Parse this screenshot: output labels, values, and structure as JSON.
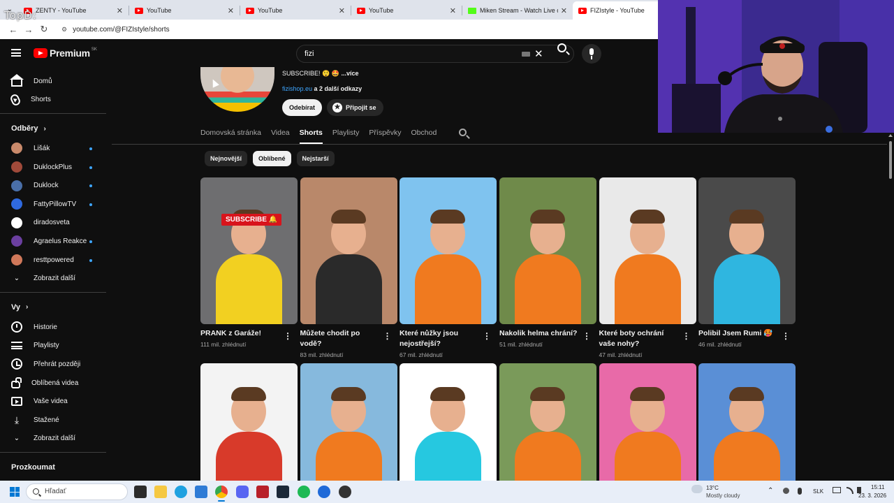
{
  "watermark": "TopD:",
  "browser": {
    "tabs": [
      {
        "title": "ZENTY - YouTube",
        "close": "✕",
        "type": "yt"
      },
      {
        "title": "YouTube",
        "close": "✕",
        "type": "yt"
      },
      {
        "title": "YouTube",
        "close": "✕",
        "type": "yt"
      },
      {
        "title": "YouTube",
        "close": "✕",
        "type": "yt"
      },
      {
        "title": "Miken Stream - Watch Live on K",
        "close": "✕",
        "type": "kick"
      },
      {
        "title": "FIZIstyle - YouTube",
        "close": "✕",
        "type": "yt"
      }
    ],
    "url": "youtube.com/@FIZIstyle/shorts"
  },
  "header": {
    "logo_text": "Premium",
    "logo_region": "SK",
    "search_value": "fizi",
    "clear_glyph": "✕"
  },
  "sidebar": {
    "main": [
      {
        "label": "Domů",
        "icon": "home-icon"
      },
      {
        "label": "Shorts",
        "icon": "shorts-icon"
      }
    ],
    "subscriptions_title": "Odběry",
    "subscriptions": [
      {
        "label": "Lišák",
        "color": "#c98a6b",
        "dot": true
      },
      {
        "label": "DuklockPlus",
        "color": "#a04a3a",
        "dot": true
      },
      {
        "label": "Duklock",
        "color": "#4a6fa8",
        "dot": true
      },
      {
        "label": "FattyPillowTV",
        "color": "#2f6ae0",
        "dot": true
      },
      {
        "label": "diradosveta",
        "color": "#ffffff",
        "dot": false
      },
      {
        "label": "Agraelus Reakce",
        "color": "#6b3fa0",
        "dot": true
      },
      {
        "label": "resttpowered",
        "color": "#d0785a",
        "dot": true
      }
    ],
    "subscriptions_more": "Zobrazit další",
    "you_title": "Vy",
    "you": [
      {
        "label": "Historie",
        "icon": "history-icon"
      },
      {
        "label": "Playlisty",
        "icon": "playlists-icon"
      },
      {
        "label": "Přehrát později",
        "icon": "watch-later-icon"
      },
      {
        "label": "Oblíbená videa",
        "icon": "liked-icon"
      },
      {
        "label": "Vaše videa",
        "icon": "your-videos-icon"
      },
      {
        "label": "Stažené",
        "icon": "download-icon"
      },
      {
        "label": "Zobrazit další",
        "icon": "chevron-down-icon"
      }
    ],
    "explore_title": "Prozkoumat"
  },
  "channel": {
    "description": "SUBSCRIBE! 😲 🤩",
    "more": "...více",
    "link": "fizishop.eu",
    "link_suffix": "a 2 další odkazy",
    "subscribe_label": "Odebírat",
    "join_label": "Připojit se",
    "tabs": [
      {
        "label": "Domovská stránka",
        "active": false
      },
      {
        "label": "Videa",
        "active": false
      },
      {
        "label": "Shorts",
        "active": true
      },
      {
        "label": "Playlisty",
        "active": false
      },
      {
        "label": "Příspěvky",
        "active": false
      },
      {
        "label": "Obchod",
        "active": false
      }
    ],
    "chips": [
      {
        "label": "Nejnovější",
        "active": false
      },
      {
        "label": "Oblíbené",
        "active": true
      },
      {
        "label": "Nejstarší",
        "active": false
      }
    ]
  },
  "shorts": [
    {
      "title": "PRANK z Garáže!",
      "views": "111 mil. zhlédnutí",
      "bg": "#6e6e70",
      "shirt": "#f2d021",
      "overlay": "SUBSCRIBE 🔔"
    },
    {
      "title": "Můžete chodit po vodě?",
      "views": "83 mil. zhlédnutí",
      "bg": "#b9886a",
      "shirt": "#2a2a2a",
      "overlay": ""
    },
    {
      "title": "Které nůžky jsou nejostřejší?",
      "views": "67 mil. zhlédnutí",
      "bg": "#7fc3ef",
      "shirt": "#f07a1f",
      "overlay": ""
    },
    {
      "title": "Nakolik helma chrání?",
      "views": "51 mil. zhlédnutí",
      "bg": "#6f8a4a",
      "shirt": "#f07a1f",
      "overlay": ""
    },
    {
      "title": "Které boty ochrání vaše nohy?",
      "views": "47 mil. zhlédnutí",
      "bg": "#e9e9e9",
      "shirt": "#f07a1f",
      "overlay": ""
    },
    {
      "title": "Polibil Jsem Rumi 🥵",
      "views": "46 mil. zhlédnutí",
      "bg": "#4a4a4a",
      "shirt": "#2fb6e0",
      "overlay": ""
    },
    {
      "title": "",
      "views": "",
      "bg": "#f3f3f3",
      "shirt": "#d83a2a",
      "overlay": ""
    },
    {
      "title": "",
      "views": "",
      "bg": "#86b9dd",
      "shirt": "#f07a1f",
      "overlay": ""
    },
    {
      "title": "",
      "views": "",
      "bg": "#ffffff",
      "shirt": "#26c8e0",
      "overlay": ""
    },
    {
      "title": "",
      "views": "",
      "bg": "#7a9a5a",
      "shirt": "#f07a1f",
      "overlay": ""
    },
    {
      "title": "",
      "views": "",
      "bg": "#e86aa8",
      "shirt": "#f07a1f",
      "overlay": ""
    },
    {
      "title": "",
      "views": "",
      "bg": "#5a8fd6",
      "shirt": "#f07a1f",
      "overlay": ""
    }
  ],
  "taskbar": {
    "search_placeholder": "Hľadať",
    "weather_temp": "13°C",
    "weather_desc": "Mostly cloudy",
    "lang": "SLK",
    "time": "15:11",
    "date": "23. 3. 2026"
  }
}
